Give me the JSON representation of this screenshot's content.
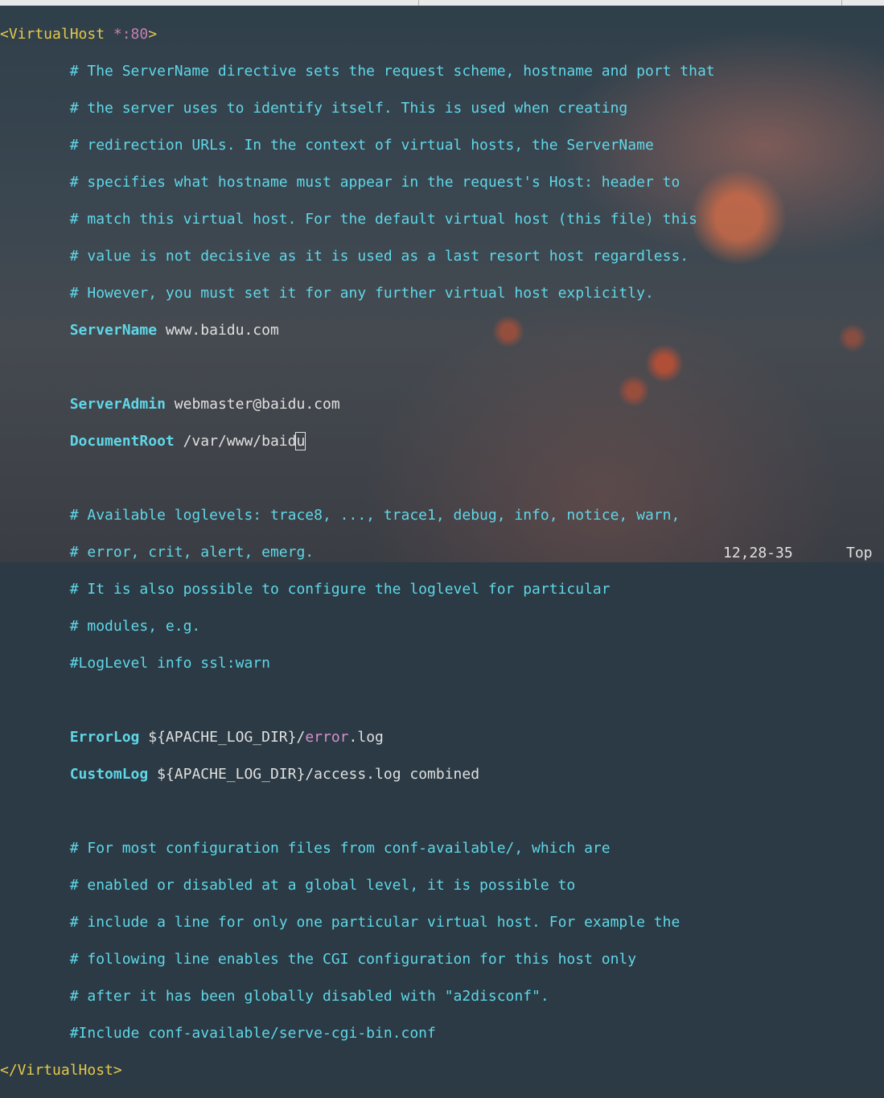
{
  "editor": {
    "vhost_open": "<VirtualHost",
    "vhost_port": " *:80",
    "vhost_open_close": ">",
    "comment_servername": [
      "# The ServerName directive sets the request scheme, hostname and port that",
      "# the server uses to identify itself. This is used when creating",
      "# redirection URLs. In the context of virtual hosts, the ServerName",
      "# specifies what hostname must appear in the request's Host: header to",
      "# match this virtual host. For the default virtual host (this file) this",
      "# value is not decisive as it is used as a last resort host regardless.",
      "# However, you must set it for any further virtual host explicitly."
    ],
    "servername_key": "ServerName",
    "servername_value": "www.baidu.com",
    "serveradmin_key": "ServerAdmin",
    "serveradmin_value": "webmaster@baidu.com",
    "docroot_key": "DocumentRoot",
    "docroot_value_before_cursor": "/var/www/baid",
    "docroot_cursor_char": "u",
    "comment_loglevel": [
      "# Available loglevels: trace8, ..., trace1, debug, info, notice, warn,",
      "# error, crit, alert, emerg.",
      "# It is also possible to configure the loglevel for particular",
      "# modules, e.g.",
      "#LogLevel info ssl:warn"
    ],
    "errorlog_key": "ErrorLog",
    "errorlog_var": "${APACHE_LOG_DIR}",
    "errorlog_slash": "/",
    "errorlog_word": "error",
    "errorlog_ext": ".log",
    "customlog_key": "CustomLog",
    "customlog_value": "${APACHE_LOG_DIR}/access.log combined",
    "comment_include": [
      "# For most configuration files from conf-available/, which are",
      "# enabled or disabled at a global level, it is possible to",
      "# include a line for only one particular virtual host. For example the",
      "# following line enables the CGI configuration for this host only",
      "# after it has been globally disabled with \"a2disconf\".",
      "#Include conf-available/serve-cgi-bin.conf"
    ],
    "vhost_close": "</VirtualHost>"
  },
  "statusbar": {
    "cursor_position": "12,28-35",
    "scroll_position": "Top"
  },
  "colors": {
    "tag": "#e6c84a",
    "comment": "#5fd7e8",
    "keyword": "#5fd7e8",
    "text": "#e0e0e0",
    "special": "#d98fd0"
  }
}
